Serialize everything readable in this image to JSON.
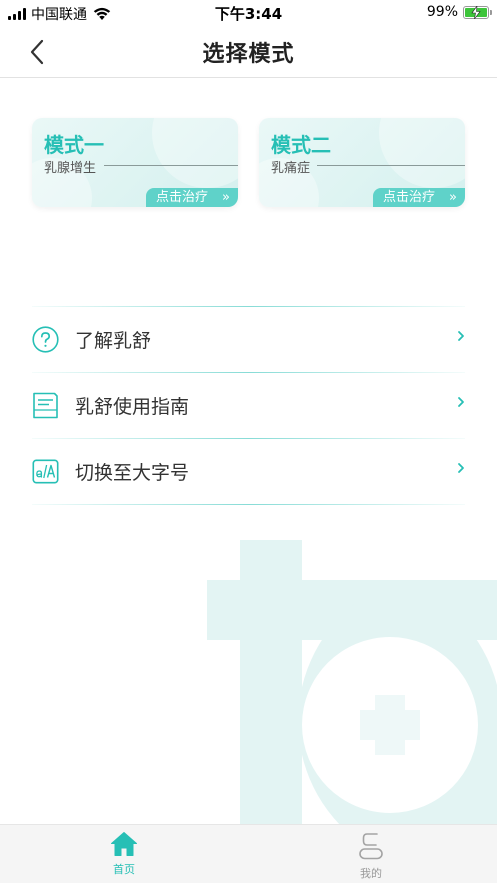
{
  "status_bar": {
    "carrier": "中国联通",
    "time": "下午3:44",
    "battery": "99%"
  },
  "nav": {
    "title": "选择模式"
  },
  "modes": [
    {
      "title": "模式一",
      "subtitle": "乳腺增生",
      "action": "点击治疗"
    },
    {
      "title": "模式二",
      "subtitle": "乳痛症",
      "action": "点击治疗"
    }
  ],
  "menu": [
    {
      "label": "了解乳舒",
      "icon": "question-circle-icon"
    },
    {
      "label": "乳舒使用指南",
      "icon": "guide-document-icon"
    },
    {
      "label": "切换至大字号",
      "icon": "font-size-icon"
    }
  ],
  "tabs": [
    {
      "label": "首页",
      "icon": "home-icon",
      "active": true
    },
    {
      "label": "我的",
      "icon": "profile-icon",
      "active": false
    }
  ],
  "colors": {
    "accent": "#26bfb5",
    "accent_light": "#5fd2c9",
    "card_bg": "#e0f5f3"
  }
}
